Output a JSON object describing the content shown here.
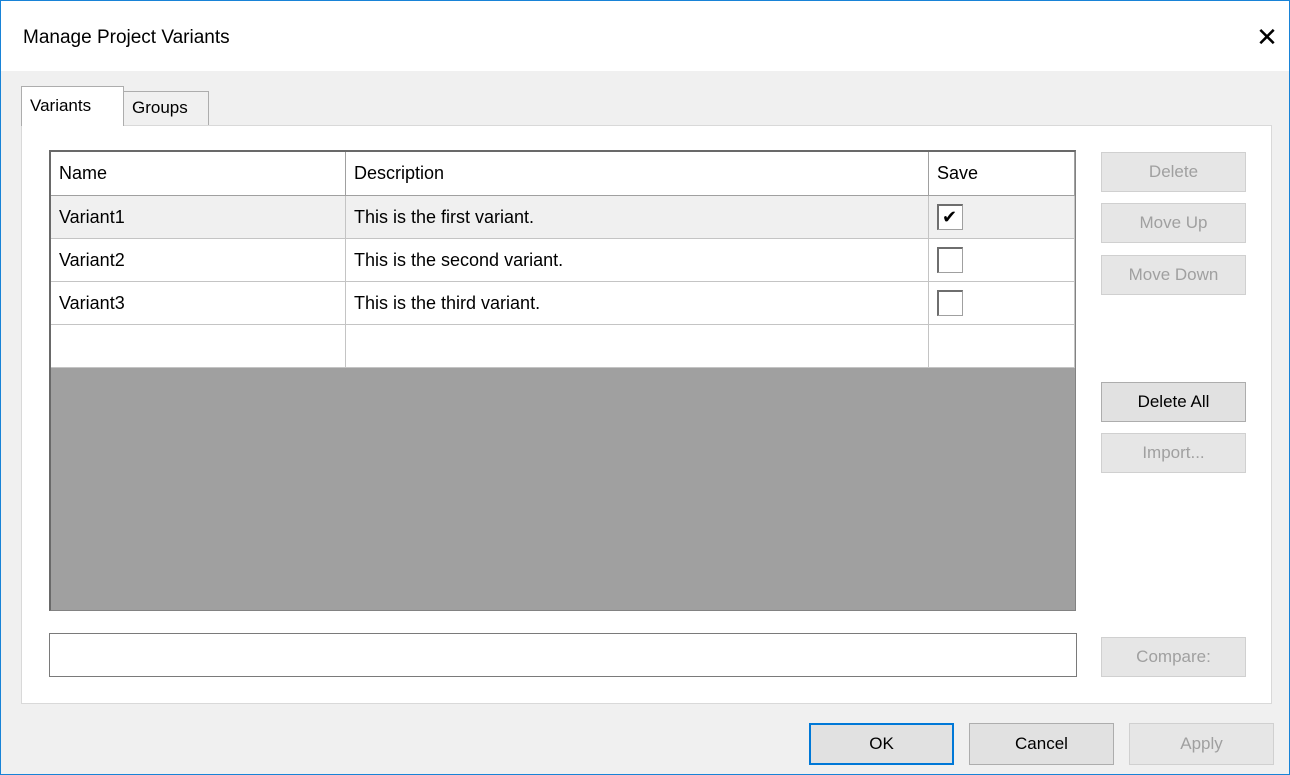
{
  "dialog": {
    "title": "Manage Project Variants",
    "close_glyph": "✕"
  },
  "tabs": [
    {
      "label": "Variants",
      "active": true
    },
    {
      "label": "Groups",
      "active": false
    }
  ],
  "grid": {
    "columns": [
      "Name",
      "Description",
      "Save"
    ],
    "rows": [
      {
        "name": "Variant1",
        "description": "This is the first variant.",
        "save": true
      },
      {
        "name": "Variant2",
        "description": "This is the second variant.",
        "save": false
      },
      {
        "name": "Variant3",
        "description": "This is the third variant.",
        "save": false
      },
      {
        "name": "",
        "description": "",
        "save": null
      }
    ]
  },
  "side_buttons": {
    "delete": "Delete",
    "move_up": "Move Up",
    "move_down": "Move Down",
    "delete_all": "Delete All",
    "import": "Import..."
  },
  "compare": {
    "value": "",
    "button": "Compare:"
  },
  "footer": {
    "ok": "OK",
    "cancel": "Cancel",
    "apply": "Apply"
  }
}
